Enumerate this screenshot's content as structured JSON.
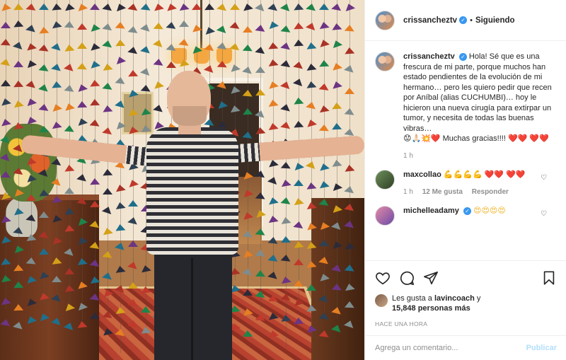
{
  "post": {
    "username": "crissancheztv",
    "follow_status": "Siguiendo",
    "caption": "Hola! Sé que es una frescura de mi parte, porque muchos han estado pendientes de la evolución de mi hermano… pero les quiero pedir que recen por Aníbal (alias CUCHUMBI)… hoy le hicieron una nueva cirugía para extirpar un tumor, y necesita de todas las buenas vibras…",
    "caption_emojis": "😟🙏🏻💥❤️",
    "caption_tail": "Muchas gracias!!!!",
    "caption_tail_hearts": "❤️❤️ ❤️❤️",
    "caption_time": "1 h",
    "likes_prefix": "Les gusta a",
    "likes_user": "lavincoach",
    "likes_connector": "y",
    "likes_count": "15,848 personas más",
    "date": "HACE UNA HORA"
  },
  "comments": [
    {
      "username": "maxcollao",
      "emojis": "💪💪💪💪",
      "hearts": "❤️❤️ ❤️❤️",
      "time": "1 h",
      "likes": "12 Me gusta",
      "reply": "Responder"
    },
    {
      "username": "michelleadamy",
      "emojis": "😍😍😍😍"
    }
  ],
  "add_comment": {
    "placeholder": "Agrega un comentario...",
    "publish": "Publicar"
  },
  "icons": {
    "like": "heart-icon",
    "comment": "comment-icon",
    "share": "share-icon",
    "save": "bookmark-icon"
  },
  "colors": {
    "verified": "#3897f0",
    "heart": "#ed4956",
    "muted": "#8e8e8e",
    "publish": "#b2dffc"
  }
}
